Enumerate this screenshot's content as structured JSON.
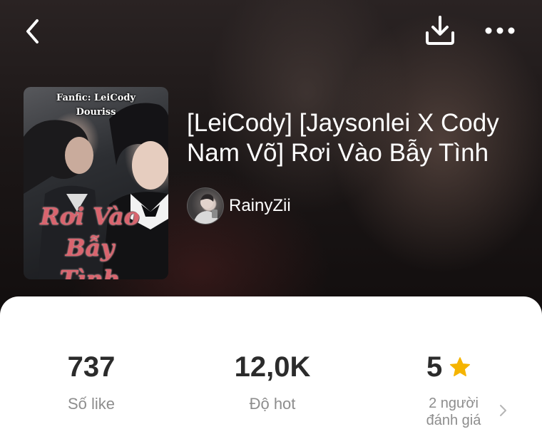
{
  "header": {
    "back_icon": "chevron-left-icon",
    "download_icon": "download-icon",
    "more_icon": "more-horizontal-icon"
  },
  "book": {
    "cover": {
      "caption_line1": "Fanfic: LeiCody",
      "caption_line2": "Douriss",
      "title_line1": "Rơi Vào",
      "title_line2": "Bẫy Tình"
    },
    "title": "[LeiCody] [Jaysonlei X Cody Nam Võ] Rơi Vào Bẫy Tình",
    "author": "RainyZii"
  },
  "stats": {
    "likes": {
      "value": "737",
      "label": "Số like"
    },
    "hot": {
      "value": "12,0K",
      "label": "Độ hot"
    },
    "rating": {
      "value": "5",
      "star_icon": "star-icon",
      "count_line1": "2 người",
      "count_line2": "đánh giá",
      "chevron_icon": "chevron-right-icon"
    }
  },
  "colors": {
    "star": "#F5B400",
    "sheet_background": "#FFFFFF",
    "stat_value": "#2B2B2B",
    "stat_label": "#8D8D8D"
  }
}
